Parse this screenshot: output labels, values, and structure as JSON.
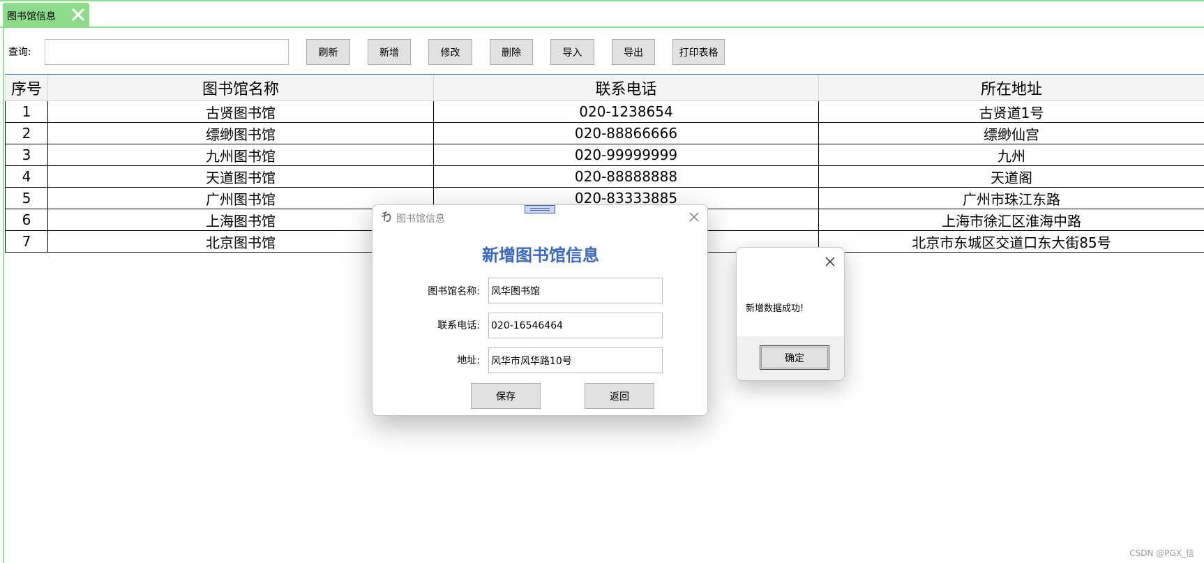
{
  "tab": {
    "label": "图书馆信息"
  },
  "toolbar": {
    "query_label": "查询:",
    "query_value": "",
    "buttons": [
      "刷新",
      "新增",
      "修改",
      "删除",
      "导入",
      "导出",
      "打印表格"
    ]
  },
  "table": {
    "headers": [
      "序号",
      "图书馆名称",
      "联系电话",
      "所在地址"
    ],
    "rows": [
      [
        "1",
        "古贤图书馆",
        "020-1238654",
        "古贤道1号"
      ],
      [
        "2",
        "缥缈图书馆",
        "020-88866666",
        "缥缈仙宫"
      ],
      [
        "3",
        "九州图书馆",
        "020-99999999",
        "九州"
      ],
      [
        "4",
        "天道图书馆",
        "020-88888888",
        "天道阁"
      ],
      [
        "5",
        "广州图书馆",
        "020-83333885",
        "广州市珠江东路"
      ],
      [
        "6",
        "上海图书馆",
        "",
        "上海市徐汇区淮海中路"
      ],
      [
        "7",
        "北京图书馆",
        "",
        "北京市东城区交道口东大街85号"
      ]
    ]
  },
  "dialog": {
    "title": "图书馆信息",
    "heading": "新增图书馆信息",
    "fields": [
      {
        "label": "图书馆名称:",
        "value": "风华图书馆"
      },
      {
        "label": "联系电话:",
        "value": "020-16546464"
      },
      {
        "label": "地址:",
        "value": "风华市风华路10号"
      }
    ],
    "save_label": "保存",
    "back_label": "返回"
  },
  "message": {
    "text": "新增数据成功!",
    "ok_label": "确定"
  },
  "watermark": "CSDN @PGX_信",
  "colors": {
    "tab_green": "#8cdc8c",
    "heading_blue": "#3b67c9",
    "button_gray": "#e1e1e1"
  }
}
